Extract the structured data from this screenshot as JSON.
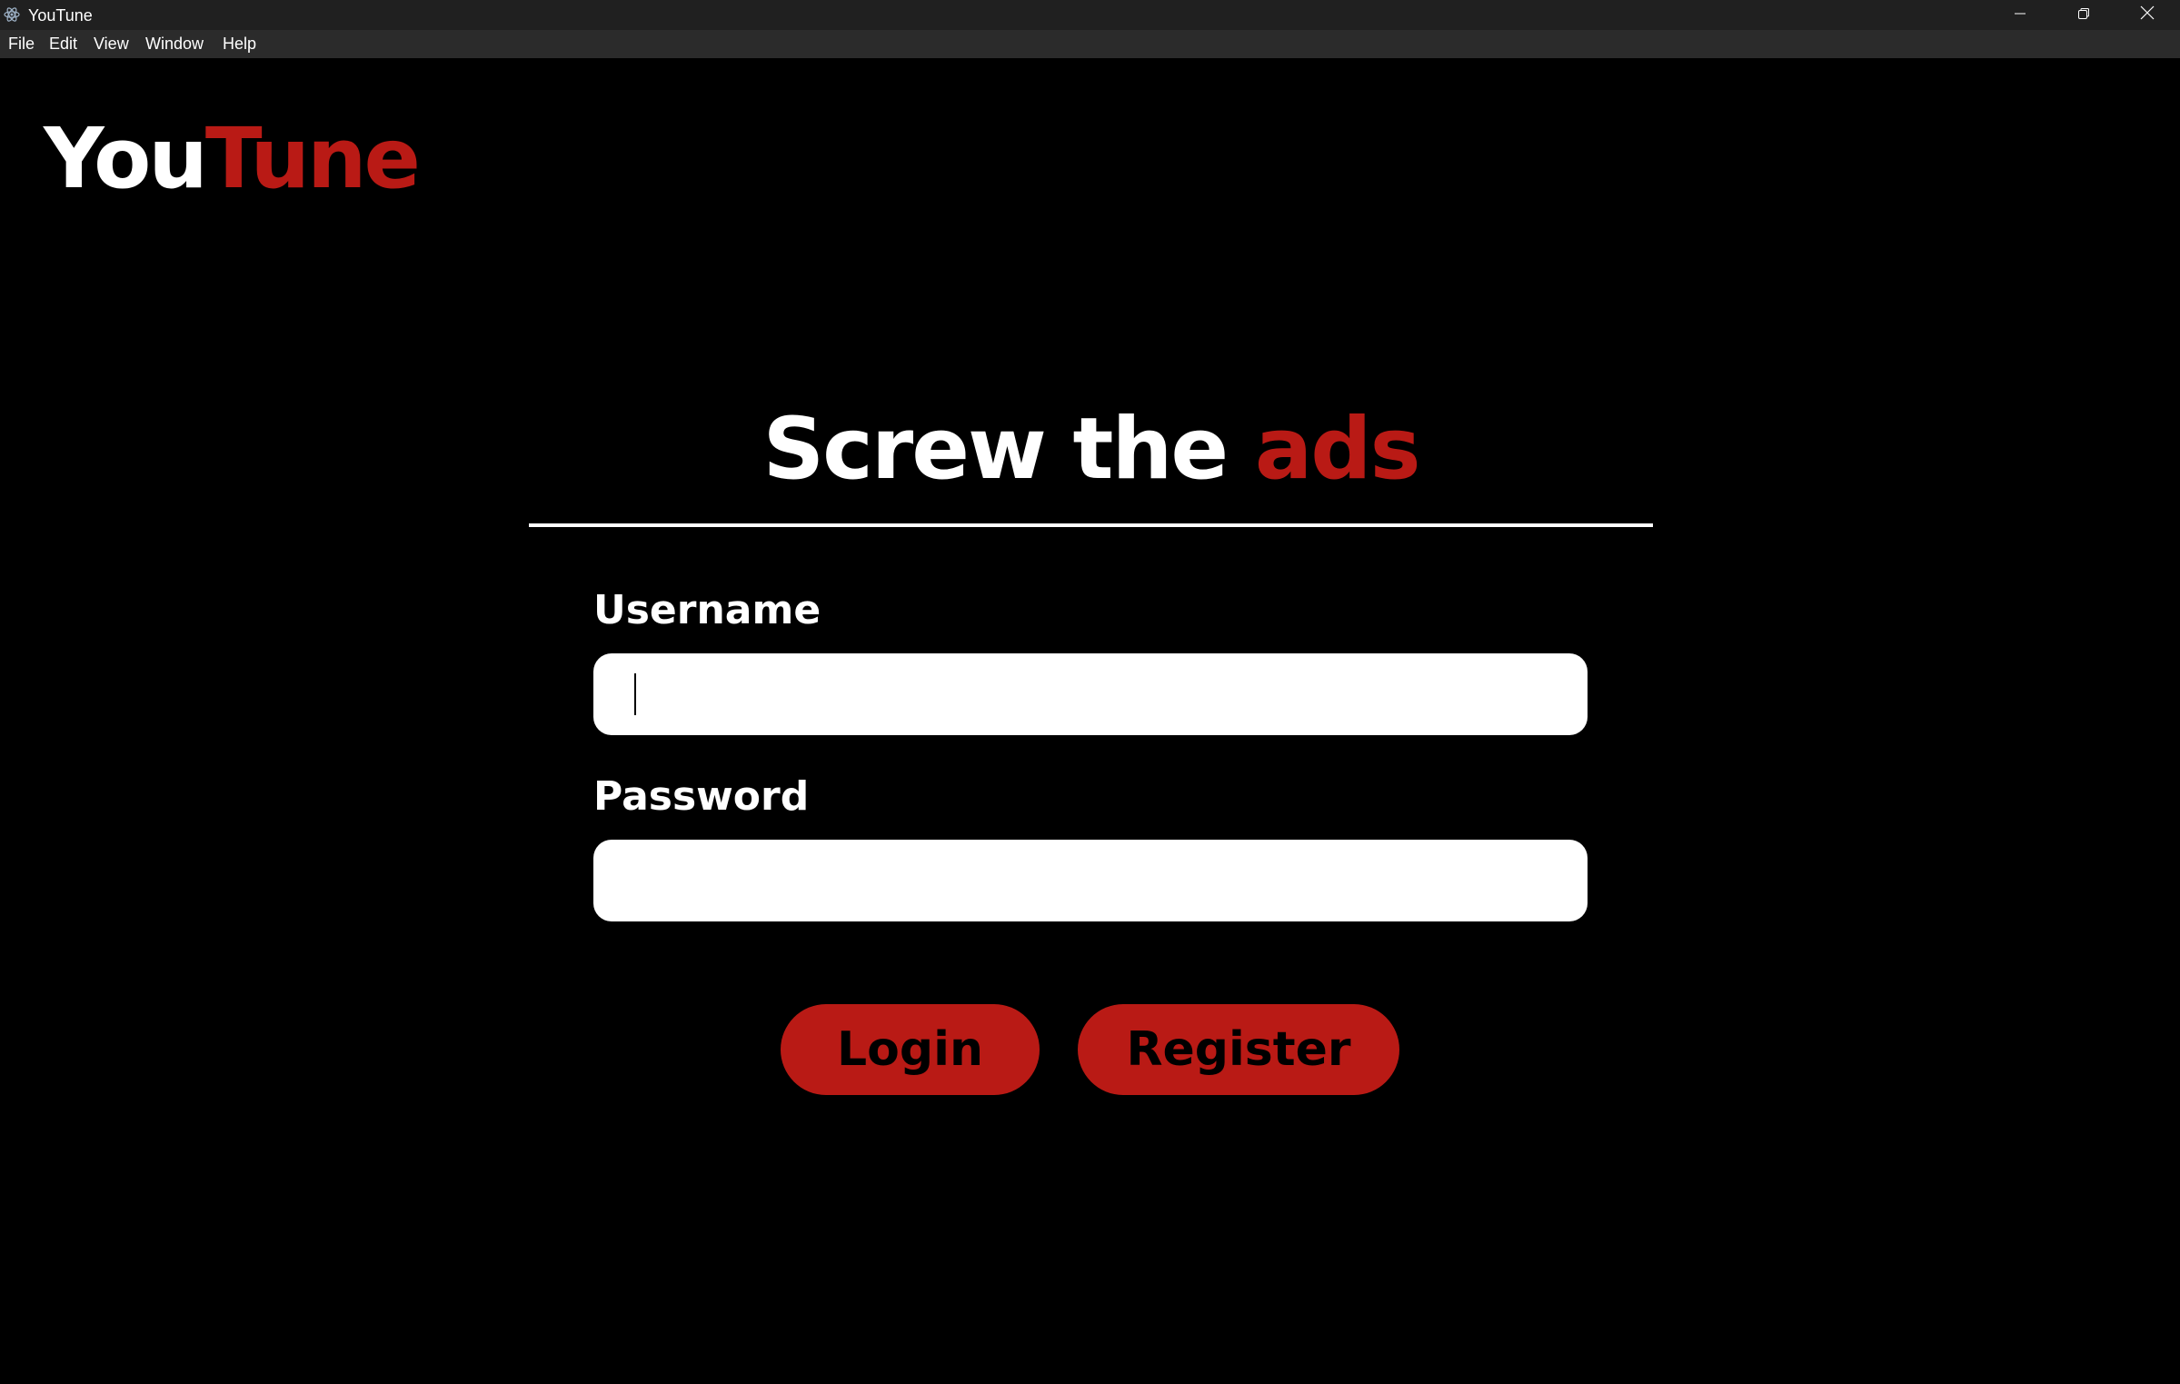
{
  "window": {
    "title": "YouTune",
    "icon": "electron-atom-icon",
    "controls": [
      "minimize-icon",
      "restore-icon",
      "close-icon"
    ]
  },
  "menubar": {
    "items": [
      {
        "label": "File"
      },
      {
        "label": "Edit"
      },
      {
        "label": "View"
      },
      {
        "label": "Window"
      },
      {
        "label": "Help"
      }
    ]
  },
  "logo": {
    "part1": "You",
    "part2": "Tune"
  },
  "headline": {
    "part1": "Screw the ",
    "part2": "ads"
  },
  "form": {
    "username_label": "Username",
    "username_value": "",
    "password_label": "Password",
    "password_value": ""
  },
  "buttons": {
    "login": "Login",
    "register": "Register"
  },
  "colors": {
    "background": "#000000",
    "accent": "#b91a15",
    "titlebar": "#202020",
    "menubar": "#2b2b2b"
  }
}
